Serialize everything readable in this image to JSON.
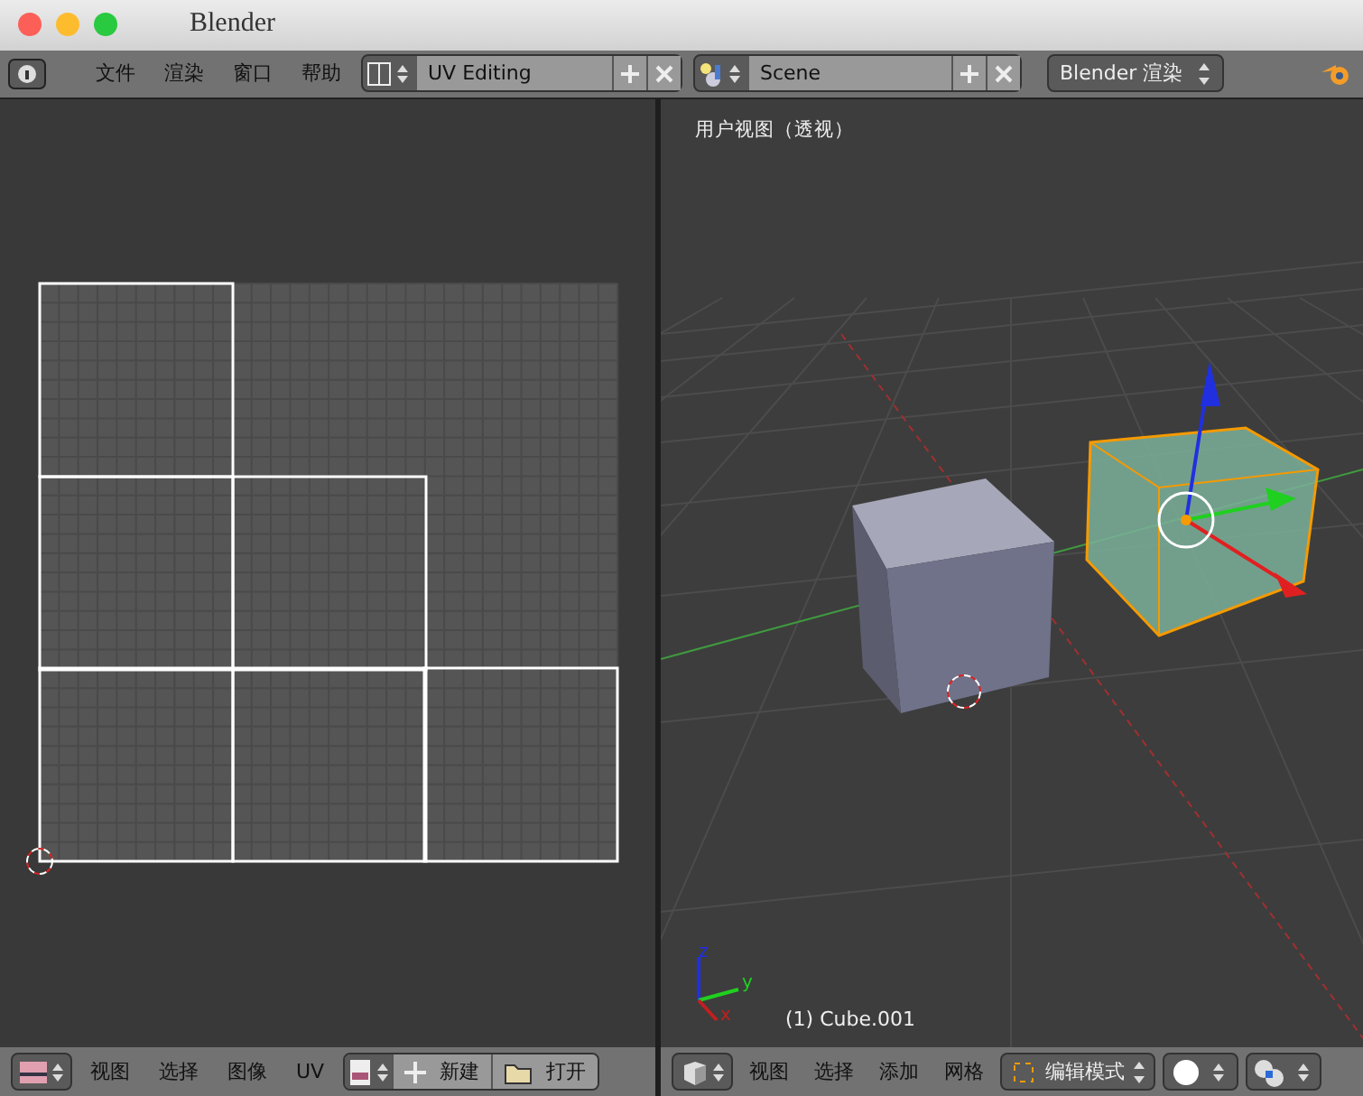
{
  "window": {
    "title": "Blender"
  },
  "top_header": {
    "menus": [
      "文件",
      "渲染",
      "窗口",
      "帮助"
    ],
    "screen_layout": "UV Editing",
    "scene": "Scene",
    "render_engine": "Blender 渲染"
  },
  "uv_editor": {
    "menus": [
      "视图",
      "选择",
      "图像",
      "UV"
    ],
    "new_button": "新建",
    "open_button": "打开"
  },
  "viewport": {
    "view_label": "用户视图（透视）",
    "object_label": "(1) Cube.001",
    "axis_labels": [
      "z",
      "y",
      "x"
    ],
    "menus": [
      "视图",
      "选择",
      "添加",
      "网格"
    ],
    "mode": "编辑模式"
  }
}
